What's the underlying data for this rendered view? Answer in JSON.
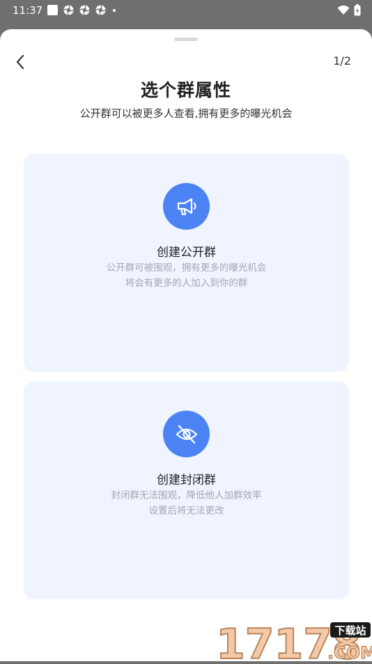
{
  "status_bar": {
    "time": "11:37"
  },
  "sheet": {
    "step": "1/2",
    "title": "选个群属性",
    "subtitle": "公开群可以被更多人查看,拥有更多的曝光机会"
  },
  "options": [
    {
      "title": "创建公开群",
      "desc_line1": "公开群可被围观，拥有更多的曝光机会",
      "desc_line2": "将会有更多的人加入到你的群",
      "icon": "megaphone-icon"
    },
    {
      "title": "创建封闭群",
      "desc_line1": "封闭群无法围观，降低他人加群效率",
      "desc_line2": "设置后将无法更改",
      "icon": "eye-off-icon"
    }
  ],
  "watermark": {
    "number": "17178",
    "label": "下载站",
    "domain": ".COM"
  },
  "colors": {
    "accent": "#4b82f4",
    "card_bg": "#eff4ff",
    "desc_text": "#a3a8b3",
    "overlay": "#6f6f6f"
  }
}
